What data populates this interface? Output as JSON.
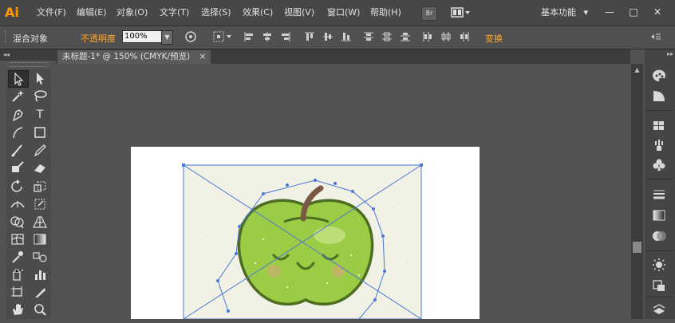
{
  "app": {
    "logo": "Ai"
  },
  "menu": {
    "items": [
      "文件(F)",
      "编辑(E)",
      "对象(O)",
      "文字(T)",
      "选择(S)",
      "效果(C)",
      "视图(V)",
      "窗口(W)",
      "帮助(H)"
    ]
  },
  "menubar_buttons": {
    "bridge": "Br",
    "arrange_icon": "arrange-documents-icon"
  },
  "workspace": {
    "label": "基本功能",
    "arrow": "▾"
  },
  "window_controls": {
    "minimize": "—",
    "maximize": "□",
    "close": "✕"
  },
  "control_bar": {
    "object_label": "混合对象",
    "opacity_label": "不透明度",
    "opacity_value": "100%",
    "transform_label": "变换"
  },
  "document": {
    "tab_title": "未标题-1* @ 150% (CMYK/预览)",
    "tab_close": "×"
  },
  "colors": {
    "accent_orange": "#ffa830",
    "apple_green": "#9ccb46",
    "stem_brown": "#7a5a44",
    "path_blue": "#4a78d6"
  }
}
